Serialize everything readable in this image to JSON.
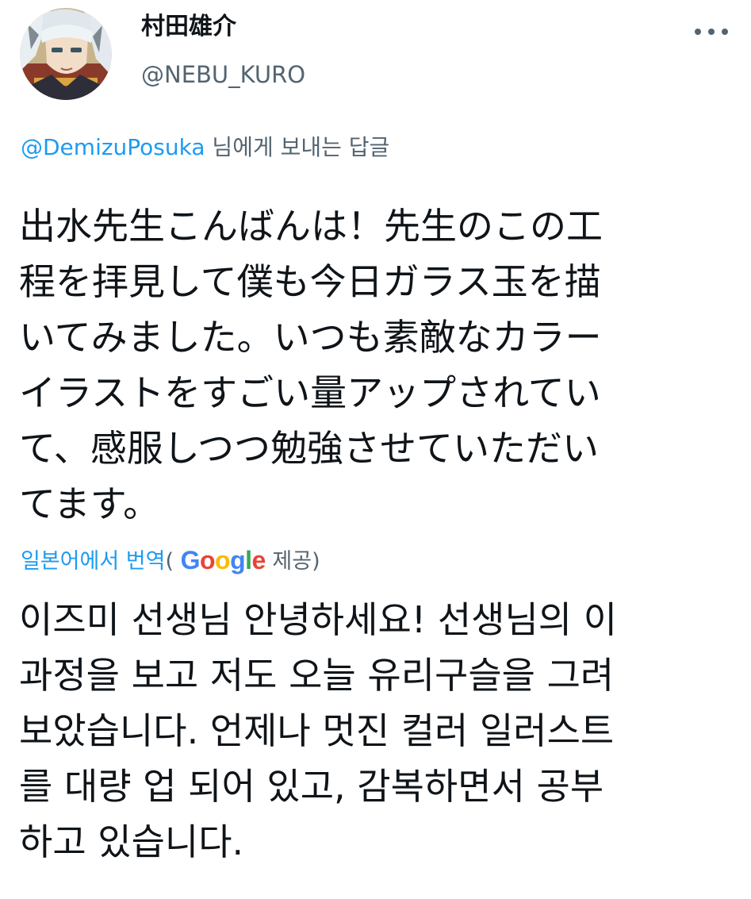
{
  "author": {
    "display_name": "村田雄介",
    "handle": "@NEBU_KURO",
    "avatar_icon": "user-avatar-illustration",
    "more_icon": "more-options-icon"
  },
  "reply": {
    "mention": "@DemizuPosuka",
    "suffix": " 님에게 보내는 답글"
  },
  "tweet": {
    "lines": [
      "出水先生こんばんは！先生のこの工",
      "程を拝見して僕も今日ガラス玉を描",
      "いてみました。いつも素敵なカラー",
      "イラストをすごい量アップされてい",
      "て、感服しつつ勉強させていただい",
      "てます。"
    ]
  },
  "translation": {
    "link_label": "일본어에서 번역",
    "open_paren": "( ",
    "google_letters": [
      "G",
      "o",
      "o",
      "g",
      "l",
      "e"
    ],
    "provided_label": " 제공)",
    "lines": [
      "이즈미 선생님 안녕하세요! 선생님의 이",
      "과정을 보고 저도 오늘 유리구슬을 그려",
      "보았습니다. 언제나 멋진 컬러 일러스트",
      "를 대량 업 되어 있고, 감복하면서 공부",
      "하고 있습니다."
    ]
  },
  "colors": {
    "link": "#1d9bf0",
    "secondary_text": "#536471",
    "primary_text": "#0f1419",
    "background": "#ffffff"
  }
}
